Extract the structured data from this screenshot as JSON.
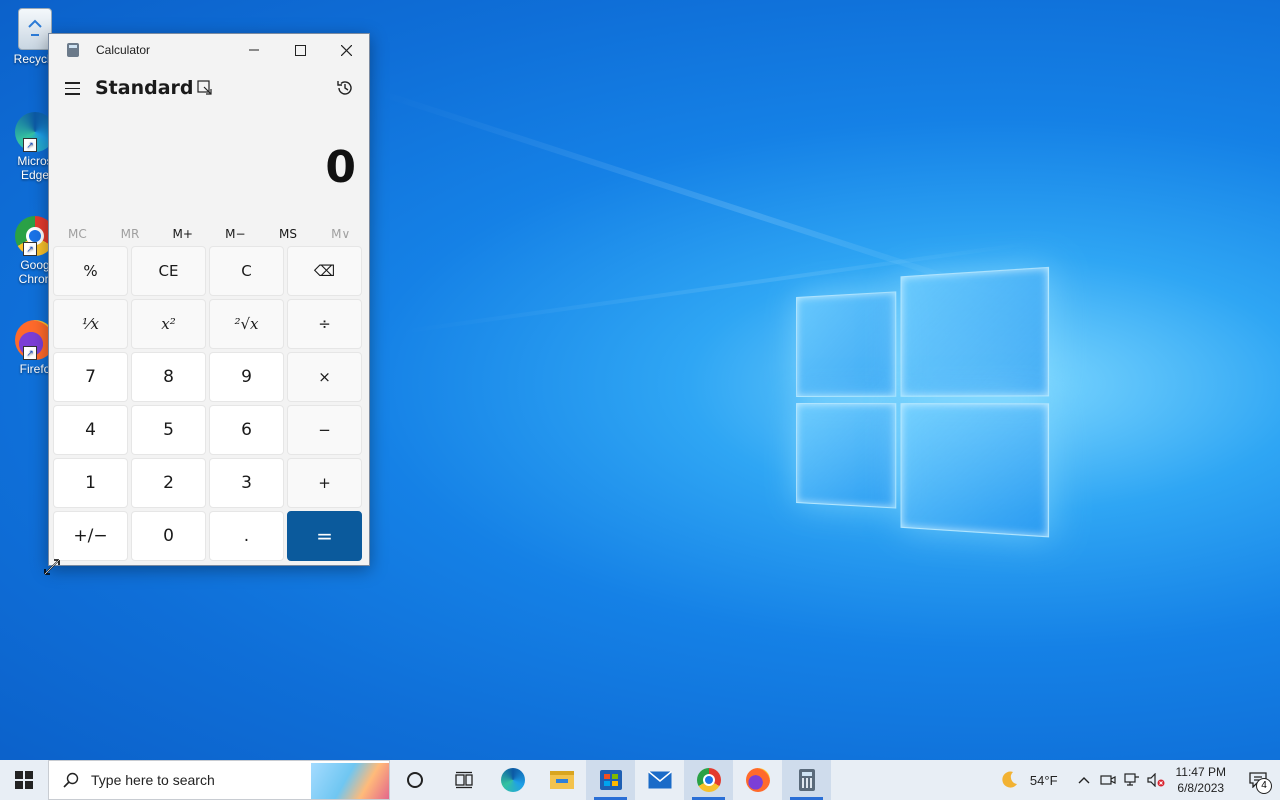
{
  "desktop": {
    "icons": [
      {
        "label": "Recycle",
        "icon": "recycle-bin-icon"
      },
      {
        "label": "Micros Edge",
        "icon": "edge-icon"
      },
      {
        "label": "Goog Chron",
        "icon": "chrome-icon"
      },
      {
        "label": "Firefo",
        "icon": "firefox-icon"
      }
    ]
  },
  "calculator": {
    "title": "Calculator",
    "mode": "Standard",
    "display": "0",
    "memory": [
      {
        "label": "MC",
        "enabled": false
      },
      {
        "label": "MR",
        "enabled": false
      },
      {
        "label": "M+",
        "enabled": true
      },
      {
        "label": "M−",
        "enabled": true
      },
      {
        "label": "MS",
        "enabled": true
      },
      {
        "label": "M∨",
        "enabled": false
      }
    ],
    "keys": [
      "%",
      "CE",
      "C",
      "⌫",
      "⅟x",
      "x²",
      "²√x",
      "÷",
      "7",
      "8",
      "9",
      "×",
      "4",
      "5",
      "6",
      "−",
      "1",
      "2",
      "3",
      "+",
      "+/−",
      "0",
      ".",
      "="
    ]
  },
  "taskbar": {
    "search_placeholder": "Type here to search",
    "apps": [
      "cortana-icon",
      "task-view-icon",
      "edge-icon",
      "file-explorer-icon",
      "store-icon",
      "mail-icon",
      "chrome-icon",
      "firefox-icon",
      "calculator-icon"
    ],
    "weather": "54°F",
    "time": "11:47 PM",
    "date": "6/8/2023",
    "notifications": "4"
  },
  "colors": {
    "accent": "#0b5a9c",
    "desktop": "#1581e6"
  }
}
